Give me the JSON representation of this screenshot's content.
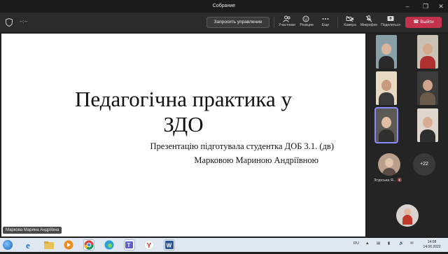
{
  "window": {
    "title": "Собрание"
  },
  "toolbar": {
    "timer": "--:--",
    "request_control_label": "Запросить управление",
    "participants_label": "Участники",
    "reactions_label": "Реакции",
    "more_label": "Еще",
    "camera_label": "Камера",
    "mic_label": "Микрофон",
    "share_label": "Поделиться",
    "leave_label": "Выйти",
    "leave_color": "#c4314b"
  },
  "slide": {
    "title_line1": "Педагогічна практика у",
    "title_line2": "ЗДО",
    "subtitle_line1": "Презентацію підготувала студентка ДОБ 3.1. (дв)",
    "subtitle_line2": "Марковою Мариною Андріївною"
  },
  "presenter_name": "Маркова Марина Андріївна",
  "participants": {
    "small_name": "Згурська Я...",
    "more_count": "+22"
  },
  "taskbar": {
    "language": "RU",
    "time": "14:08",
    "date": "14.06.2022"
  }
}
